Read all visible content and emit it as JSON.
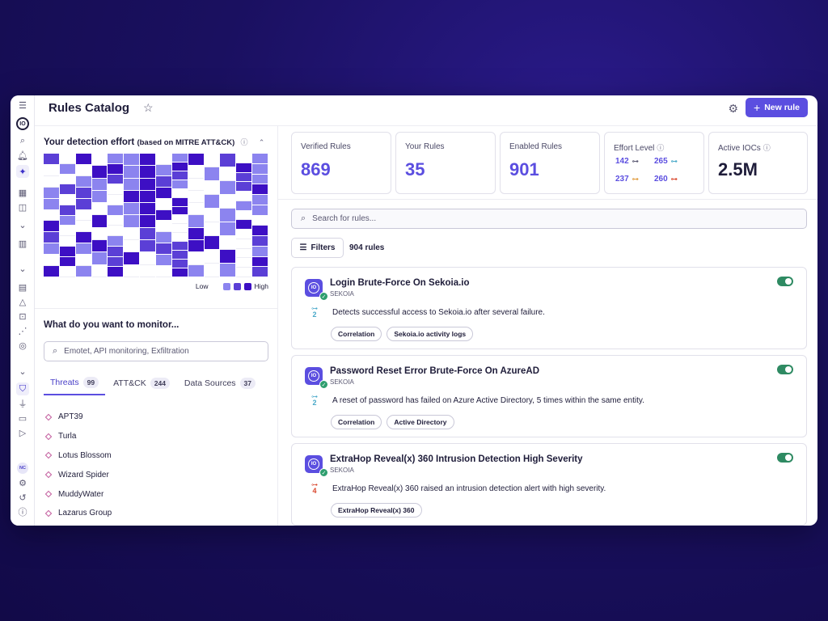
{
  "header": {
    "title": "Rules Catalog",
    "new_rule_label": "New rule"
  },
  "rail": {
    "avatar_initials": "NC",
    "logo_text": "IO"
  },
  "effort": {
    "title": "Your detection effort",
    "subtitle": "(based on MITRE ATT&CK)",
    "legend_low": "Low",
    "legend_high": "High",
    "colors": {
      "none": "#ffffff",
      "low": "#8c84ef",
      "mid": "#5b3fd6",
      "high": "#3d0fc4"
    }
  },
  "monitor": {
    "title": "What do you want to monitor...",
    "search_placeholder": "Emotet, API monitoring, Exfiltration",
    "tabs": [
      {
        "label": "Threats",
        "count": "99"
      },
      {
        "label": "ATT&CK",
        "count": "244"
      },
      {
        "label": "Data Sources",
        "count": "37"
      }
    ],
    "threats": [
      "APT39",
      "Turla",
      "Lotus Blossom",
      "Wizard Spider",
      "MuddyWater",
      "Lazarus Group"
    ]
  },
  "stats": {
    "verified": {
      "label": "Verified Rules",
      "value": "869"
    },
    "yours": {
      "label": "Your Rules",
      "value": "35"
    },
    "enabled": {
      "label": "Enabled Rules",
      "value": "901"
    },
    "effort": {
      "label": "Effort Level",
      "values": [
        "142",
        "265",
        "237",
        "260"
      ]
    },
    "iocs": {
      "label": "Active IOCs",
      "value": "2.5M"
    }
  },
  "rules": {
    "search_placeholder": "Search for rules...",
    "filters_label": "Filters",
    "count_text": "904 rules",
    "cards": [
      {
        "title": "Login Brute-Force On Sekoia.io",
        "vendor": "SEKOIA",
        "level": "2",
        "level_color": "#4aa9c9",
        "description": "Detects successful access to Sekoia.io after several failure.",
        "tags": [
          "Correlation",
          "Sekoia.io activity logs"
        ],
        "enabled": true
      },
      {
        "title": "Password Reset Error Brute-Force On AzureAD",
        "vendor": "SEKOIA",
        "level": "2",
        "level_color": "#4aa9c9",
        "description": "A reset of password has failed on Azure Active Directory, 5 times within the same entity.",
        "tags": [
          "Correlation",
          "Active Directory"
        ],
        "enabled": true
      },
      {
        "title": "ExtraHop Reveal(x) 360 Intrusion Detection High Severity",
        "vendor": "SEKOIA",
        "level": "4",
        "level_color": "#d9452b",
        "description": "ExtraHop Reveal(x) 360 raised an intrusion detection alert with high severity.",
        "tags": [
          "ExtraHop Reveal(x) 360"
        ],
        "enabled": true
      }
    ]
  }
}
